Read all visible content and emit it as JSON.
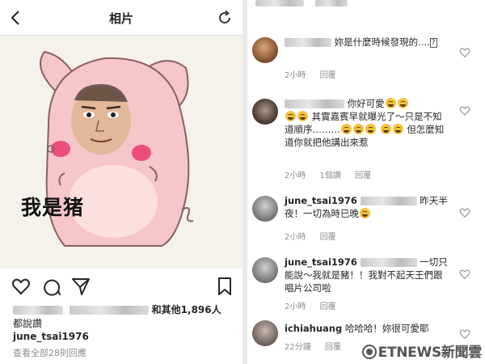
{
  "left": {
    "header_title": "相片",
    "meme_caption": "我是猪",
    "likes_suffix": "和其他1,896人",
    "likes_line2": "都說讚",
    "poster_username": "june_tsai1976",
    "view_all": "查看全部28則回應"
  },
  "right": {
    "comments": [
      {
        "username": "",
        "text": "妳是什麼時候發現的....?",
        "time": "2小時",
        "likes": "",
        "reply": "回覆"
      },
      {
        "username": "",
        "text": "你好可愛 其實嘉賓早就曝光了～只是不知道順序……… 但怎麼知道你就把他講出來惹",
        "time": "2小時",
        "likes": "1個讚",
        "reply": "回覆"
      },
      {
        "username": "june_tsai1976",
        "text": "昨天半夜！一切為時已晚",
        "time": "2小時",
        "likes": "",
        "reply": "回覆"
      },
      {
        "username": "june_tsai1976",
        "text": "一切只能說～我就是豬！！我對不起天王們跟唱片公司啦",
        "time": "2小時",
        "likes": "",
        "reply": "回覆"
      },
      {
        "username": "ichiahuang",
        "text": "哈哈哈！妳很可愛耶",
        "time": "22分鐘",
        "likes": "",
        "reply": "回覆"
      }
    ],
    "c1_text": "妳是什麼時候發現的....",
    "c2_text_a": "你好可愛",
    "c2_text_b": "其實嘉賓早就曝光了～只是不知道順序………",
    "c2_text_c": "但怎麼知道你就把他講出來惹",
    "c3_text": "昨天半夜！一切為時已晚",
    "c4_text": "一切只能說～我就是豬！！我對不起天王們跟唱片公司啦",
    "c5_text": "哈哈哈！妳很可愛耶"
  },
  "watermark": "ETNEWS新聞雲",
  "icons": {
    "back": "chevron-left-icon",
    "refresh": "refresh-icon",
    "like": "heart-icon",
    "comment": "comment-icon",
    "share": "send-icon",
    "save": "bookmark-icon",
    "comment_like": "heart-outline-icon"
  },
  "colors": {
    "text": "#262626",
    "meta": "#8e8e8e",
    "divider": "#dbdbdb",
    "cheek": "#e83a6e",
    "pig_skin": "#f6c6c9"
  }
}
